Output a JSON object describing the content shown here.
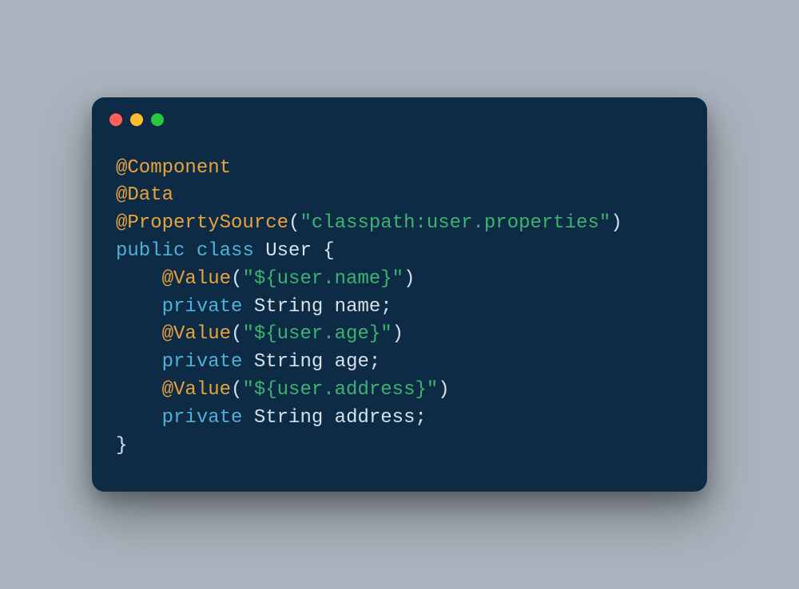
{
  "colors": {
    "background": "#aab3bd",
    "window": "#0d2b45",
    "dot_red": "#ff5f56",
    "dot_yellow": "#ffbd2e",
    "dot_green": "#27c93f",
    "annotation": "#e8a33d",
    "string": "#3cb371",
    "keyword": "#4fb1d8",
    "text": "#d6e1ea"
  },
  "code": {
    "line1": {
      "annotation": "@Component"
    },
    "line2": {
      "annotation": "@Data"
    },
    "line3": {
      "annotation": "@PropertySource",
      "paren_open": "(",
      "string": "\"classpath:user.properties\"",
      "paren_close": ")"
    },
    "line4": {
      "kw_public": "public",
      "kw_class": "class",
      "type": "User",
      "brace_open": "{"
    },
    "line5": {
      "indent": "    ",
      "annotation": "@Value",
      "paren_open": "(",
      "string": "\"${user.name}\"",
      "paren_close": ")"
    },
    "line6": {
      "indent": "    ",
      "kw_private": "private",
      "type": "String",
      "ident": "name",
      "semi": ";"
    },
    "line7": {
      "indent": "    ",
      "annotation": "@Value",
      "paren_open": "(",
      "string": "\"${user.age}\"",
      "paren_close": ")"
    },
    "line8": {
      "indent": "    ",
      "kw_private": "private",
      "type": "String",
      "ident": "age",
      "semi": ";"
    },
    "line9": {
      "indent": "    ",
      "annotation": "@Value",
      "paren_open": "(",
      "string": "\"${user.address}\"",
      "paren_close": ")"
    },
    "line10": {
      "indent": "    ",
      "kw_private": "private",
      "type": "String",
      "ident": "address",
      "semi": ";"
    },
    "line11": {
      "brace_close": "}"
    }
  }
}
